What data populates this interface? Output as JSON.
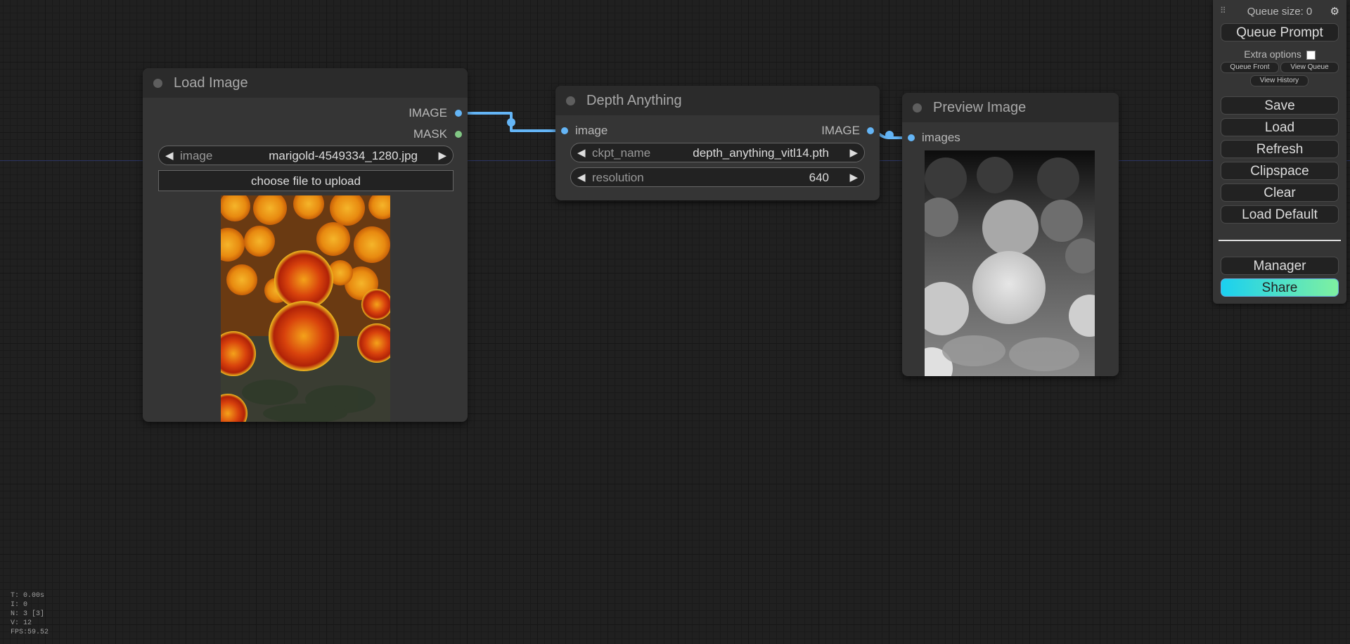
{
  "nodes": {
    "load_image": {
      "title": "Load Image",
      "outputs": [
        "IMAGE",
        "MASK"
      ],
      "widget_image": {
        "label": "image",
        "value": "marigold-4549334_1280.jpg"
      },
      "upload_label": "choose file to upload"
    },
    "depth_anything": {
      "title": "Depth Anything",
      "input": "image",
      "output": "IMAGE",
      "widget_ckpt": {
        "label": "ckpt_name",
        "value": "depth_anything_vitl14.pth"
      },
      "widget_resolution": {
        "label": "resolution",
        "value": "640"
      }
    },
    "preview_image": {
      "title": "Preview Image",
      "input": "images"
    }
  },
  "menu": {
    "queue_size": "Queue size: 0",
    "queue_prompt": "Queue Prompt",
    "extra_options": "Extra options",
    "queue_front": "Queue Front",
    "view_queue": "View Queue",
    "view_history": "View History",
    "save": "Save",
    "load": "Load",
    "refresh": "Refresh",
    "clipspace": "Clipspace",
    "clear": "Clear",
    "load_default": "Load Default",
    "manager": "Manager",
    "share": "Share"
  },
  "stats": {
    "t": "T: 0.00s",
    "i": "I: 0",
    "n": "N: 3 [3]",
    "v": "V: 12",
    "fps": "FPS:59.52"
  },
  "colors": {
    "image_link": "#64b5f6",
    "mask_slot": "#81c784",
    "share_gradient_start": "#1ad0f0",
    "share_gradient_end": "#7ff0a0"
  },
  "icons": {
    "gear": "gear-icon",
    "drag": "drag-handle-icon",
    "arrow_left": "arrow-left-icon",
    "arrow_right": "arrow-right-icon"
  }
}
